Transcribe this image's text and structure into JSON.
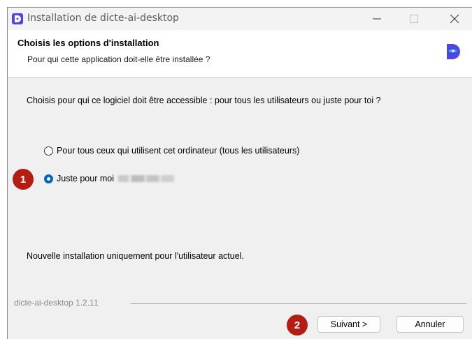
{
  "window": {
    "title": "Installation de dicte-ai-desktop"
  },
  "header": {
    "title": "Choisis les options d'installation",
    "subtitle": "Pour qui cette application doit-elle être installée ?"
  },
  "main": {
    "question": "Choisis pour qui ce logiciel doit être accessible : pour tous les utilisateurs ou juste pour toi ?",
    "options": [
      {
        "label": "Pour tous ceux qui utilisent cet ordinateur (tous les utilisateurs)",
        "selected": false
      },
      {
        "label": "Juste pour moi",
        "selected": true
      }
    ],
    "note": "Nouvelle installation uniquement pour l'utilisateur actuel."
  },
  "footer": {
    "version": "dicte-ai-desktop 1.2.11",
    "next_label": "Suivant >",
    "cancel_label": "Annuler"
  },
  "annotations": {
    "step1": "1",
    "step2": "2",
    "color": "#b41e12"
  },
  "colors": {
    "accent": "#0067c0",
    "brand": "#4f46e5"
  },
  "icons": {
    "app": "dicte-app-icon",
    "minimize": "minimize-icon",
    "maximize": "maximize-icon",
    "close": "close-icon",
    "logo": "dicte-logo-icon"
  }
}
